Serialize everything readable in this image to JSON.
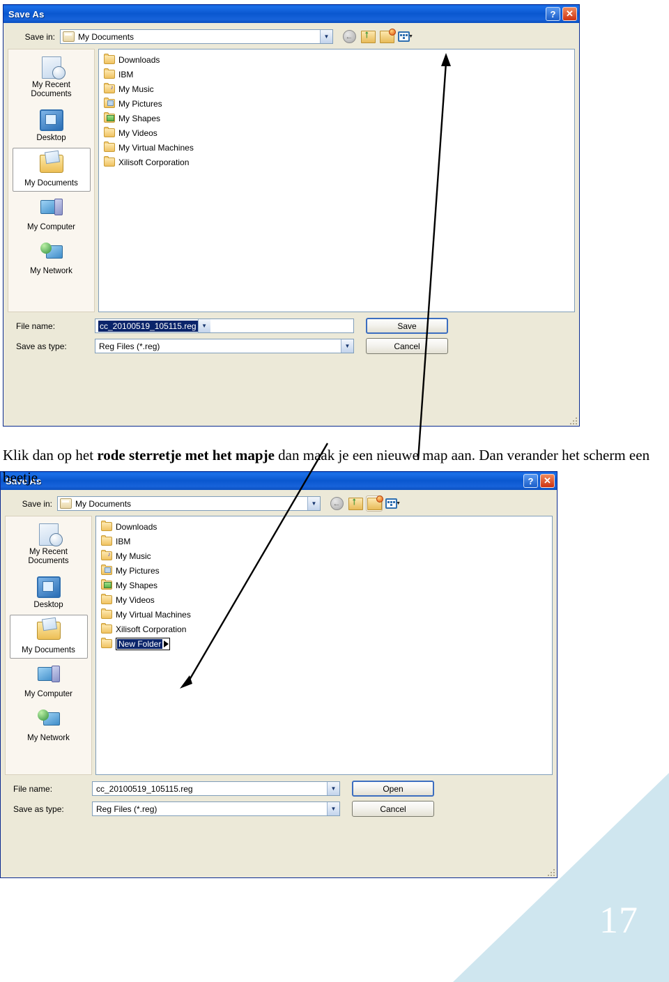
{
  "page": {
    "number": "17",
    "accent_color": "#cfe6ef"
  },
  "caption": {
    "part1": "Klik dan op het ",
    "bold": "rode sterretje met het mapje",
    "part2": " dan maak je een nieuwe map aan. Dan verander het scherm een beetje."
  },
  "dialog1": {
    "title": "Save As",
    "help_label": "?",
    "close_label": "✕",
    "savein_label": "Save in:",
    "savein_value": "My Documents",
    "toolbar": {
      "back": "back-icon",
      "up": "up-one-level-icon",
      "new_folder": "new-folder-icon",
      "views": "views-icon"
    },
    "places": [
      {
        "label": "My Recent Documents",
        "icon": "recent-documents-icon",
        "selected": false
      },
      {
        "label": "Desktop",
        "icon": "desktop-icon",
        "selected": false
      },
      {
        "label": "My Documents",
        "icon": "my-documents-icon",
        "selected": true
      },
      {
        "label": "My Computer",
        "icon": "my-computer-icon",
        "selected": false
      },
      {
        "label": "My Network",
        "icon": "my-network-icon",
        "selected": false
      }
    ],
    "files": [
      {
        "name": "Downloads",
        "icon": "folder-icon"
      },
      {
        "name": "IBM",
        "icon": "folder-icon"
      },
      {
        "name": "My Music",
        "icon": "folder-music-icon"
      },
      {
        "name": "My Pictures",
        "icon": "folder-pictures-icon"
      },
      {
        "name": "My Shapes",
        "icon": "folder-shapes-icon"
      },
      {
        "name": "My Videos",
        "icon": "folder-icon"
      },
      {
        "name": "My Virtual Machines",
        "icon": "folder-icon"
      },
      {
        "name": "Xilisoft Corporation",
        "icon": "folder-icon"
      }
    ],
    "filename_label": "File name:",
    "filename_value": "cc_20100519_105115.reg",
    "filetype_label": "Save as type:",
    "filetype_value": "Reg Files (*.reg)",
    "primary_button": "Save",
    "cancel_button": "Cancel"
  },
  "dialog2": {
    "title": "Save As",
    "help_label": "?",
    "close_label": "✕",
    "savein_label": "Save in:",
    "savein_value": "My Documents",
    "places": [
      {
        "label": "My Recent Documents",
        "icon": "recent-documents-icon",
        "selected": false
      },
      {
        "label": "Desktop",
        "icon": "desktop-icon",
        "selected": false
      },
      {
        "label": "My Documents",
        "icon": "my-documents-icon",
        "selected": true
      },
      {
        "label": "My Computer",
        "icon": "my-computer-icon",
        "selected": false
      },
      {
        "label": "My Network",
        "icon": "my-network-icon",
        "selected": false
      }
    ],
    "files": [
      {
        "name": "Downloads",
        "icon": "folder-icon"
      },
      {
        "name": "IBM",
        "icon": "folder-icon"
      },
      {
        "name": "My Music",
        "icon": "folder-music-icon"
      },
      {
        "name": "My Pictures",
        "icon": "folder-pictures-icon"
      },
      {
        "name": "My Shapes",
        "icon": "folder-shapes-icon"
      },
      {
        "name": "My Videos",
        "icon": "folder-icon"
      },
      {
        "name": "My Virtual Machines",
        "icon": "folder-icon"
      },
      {
        "name": "Xilisoft Corporation",
        "icon": "folder-icon"
      }
    ],
    "new_folder_name": "New Folder",
    "filename_label": "File name:",
    "filename_value": "cc_20100519_105115.reg",
    "filetype_label": "Save as type:",
    "filetype_value": "Reg Files (*.reg)",
    "primary_button": "Open",
    "cancel_button": "Cancel"
  }
}
